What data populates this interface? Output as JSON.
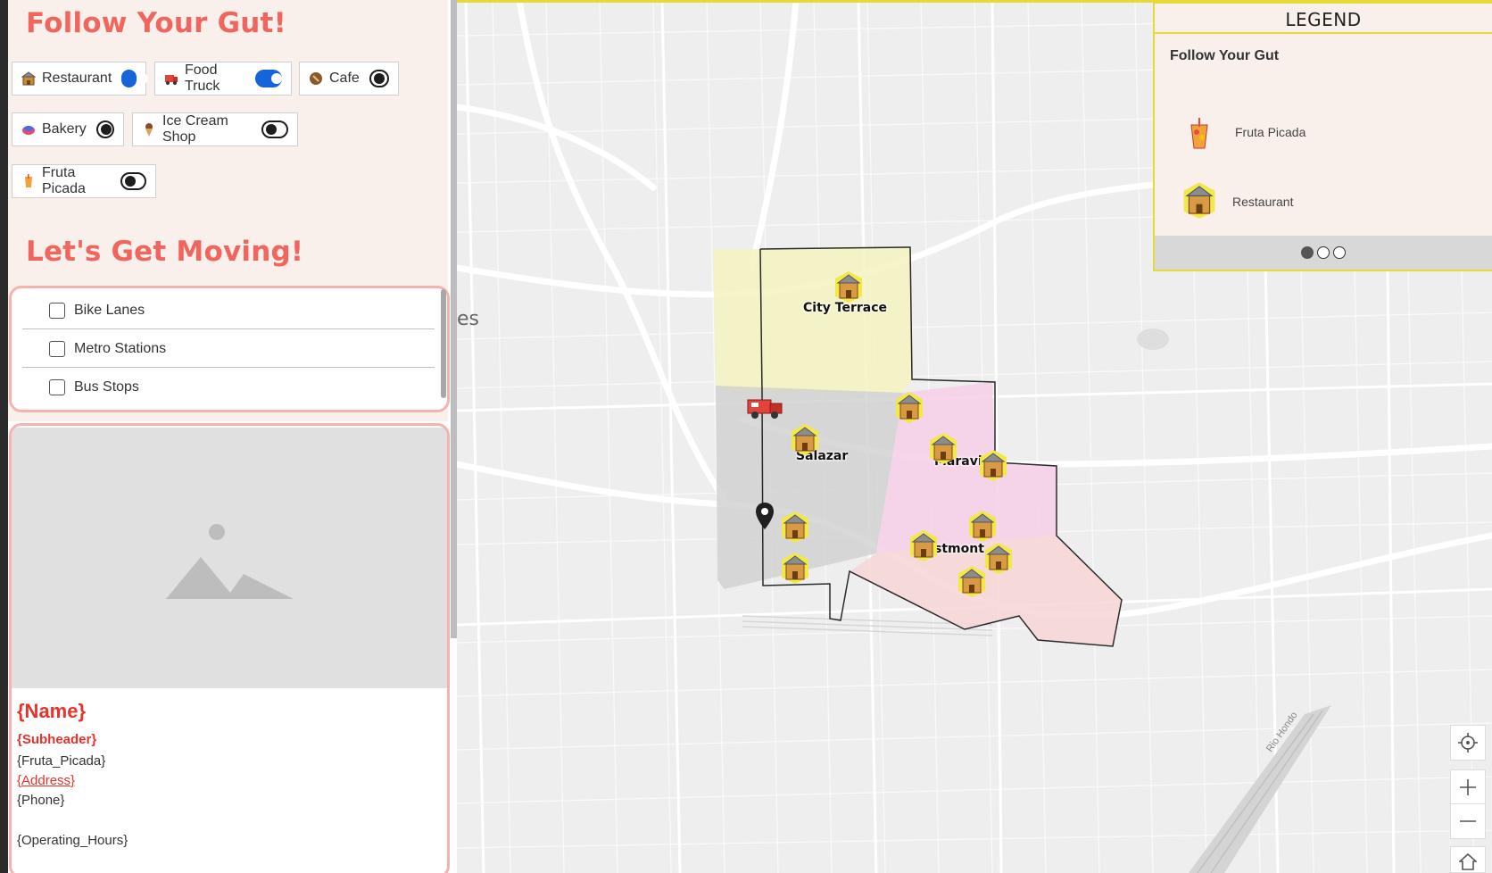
{
  "follow_section": {
    "title": "Follow Your Gut!",
    "filters": [
      {
        "label": "Restaurant",
        "icon": "restaurant-icon",
        "on": true
      },
      {
        "label": "Food Truck",
        "icon": "food-truck-icon",
        "on": true
      },
      {
        "label": "Cafe",
        "icon": "cafe-icon",
        "on": false
      },
      {
        "label": "Bakery",
        "icon": "bakery-icon",
        "on": false
      },
      {
        "label": "Ice Cream Shop",
        "icon": "ice-cream-icon",
        "on": false
      },
      {
        "label": "Fruta Picada",
        "icon": "fruta-picada-icon",
        "on": false
      }
    ]
  },
  "moving_section": {
    "title": "Let's Get Moving!",
    "layers": [
      {
        "label": "Bike Lanes",
        "checked": false
      },
      {
        "label": "Metro Stations",
        "checked": false
      },
      {
        "label": "Bus Stops",
        "checked": false
      }
    ]
  },
  "info_card": {
    "name": "{Name}",
    "subheader": "{Subheader}",
    "fruta": "{Fruta_Picada}",
    "address": "{Address}",
    "phone": "{Phone}",
    "hours": "{Operating_Hours}"
  },
  "legend": {
    "header": "LEGEND",
    "layer_title": "Follow Your Gut",
    "items": [
      {
        "label": "Fruta Picada",
        "icon": "fruta-picada-icon"
      },
      {
        "label": "Restaurant",
        "icon": "restaurant-icon"
      }
    ],
    "pages": 3,
    "active_page": 1
  },
  "map": {
    "neighborhoods": [
      {
        "name": "City Terrace",
        "color": "#f3f3c0"
      },
      {
        "name": "Salazar",
        "color": "#d6d6d6"
      },
      {
        "name": "Maravilla",
        "color": "#f6cfe8"
      },
      {
        "name": "Eastmont",
        "color": "#f7d6d6"
      }
    ],
    "partial_label": "es",
    "river_label": "Rio Hondo",
    "controls": [
      "locate-button",
      "zoom-in-button",
      "zoom-out-button",
      "home-button"
    ]
  },
  "colors": {
    "accent": "#f0665e",
    "toggle_on": "#1565d8",
    "legend_border": "#e6d93a",
    "card_border": "#f6b3ad",
    "panel_bg": "#faf0eb"
  }
}
